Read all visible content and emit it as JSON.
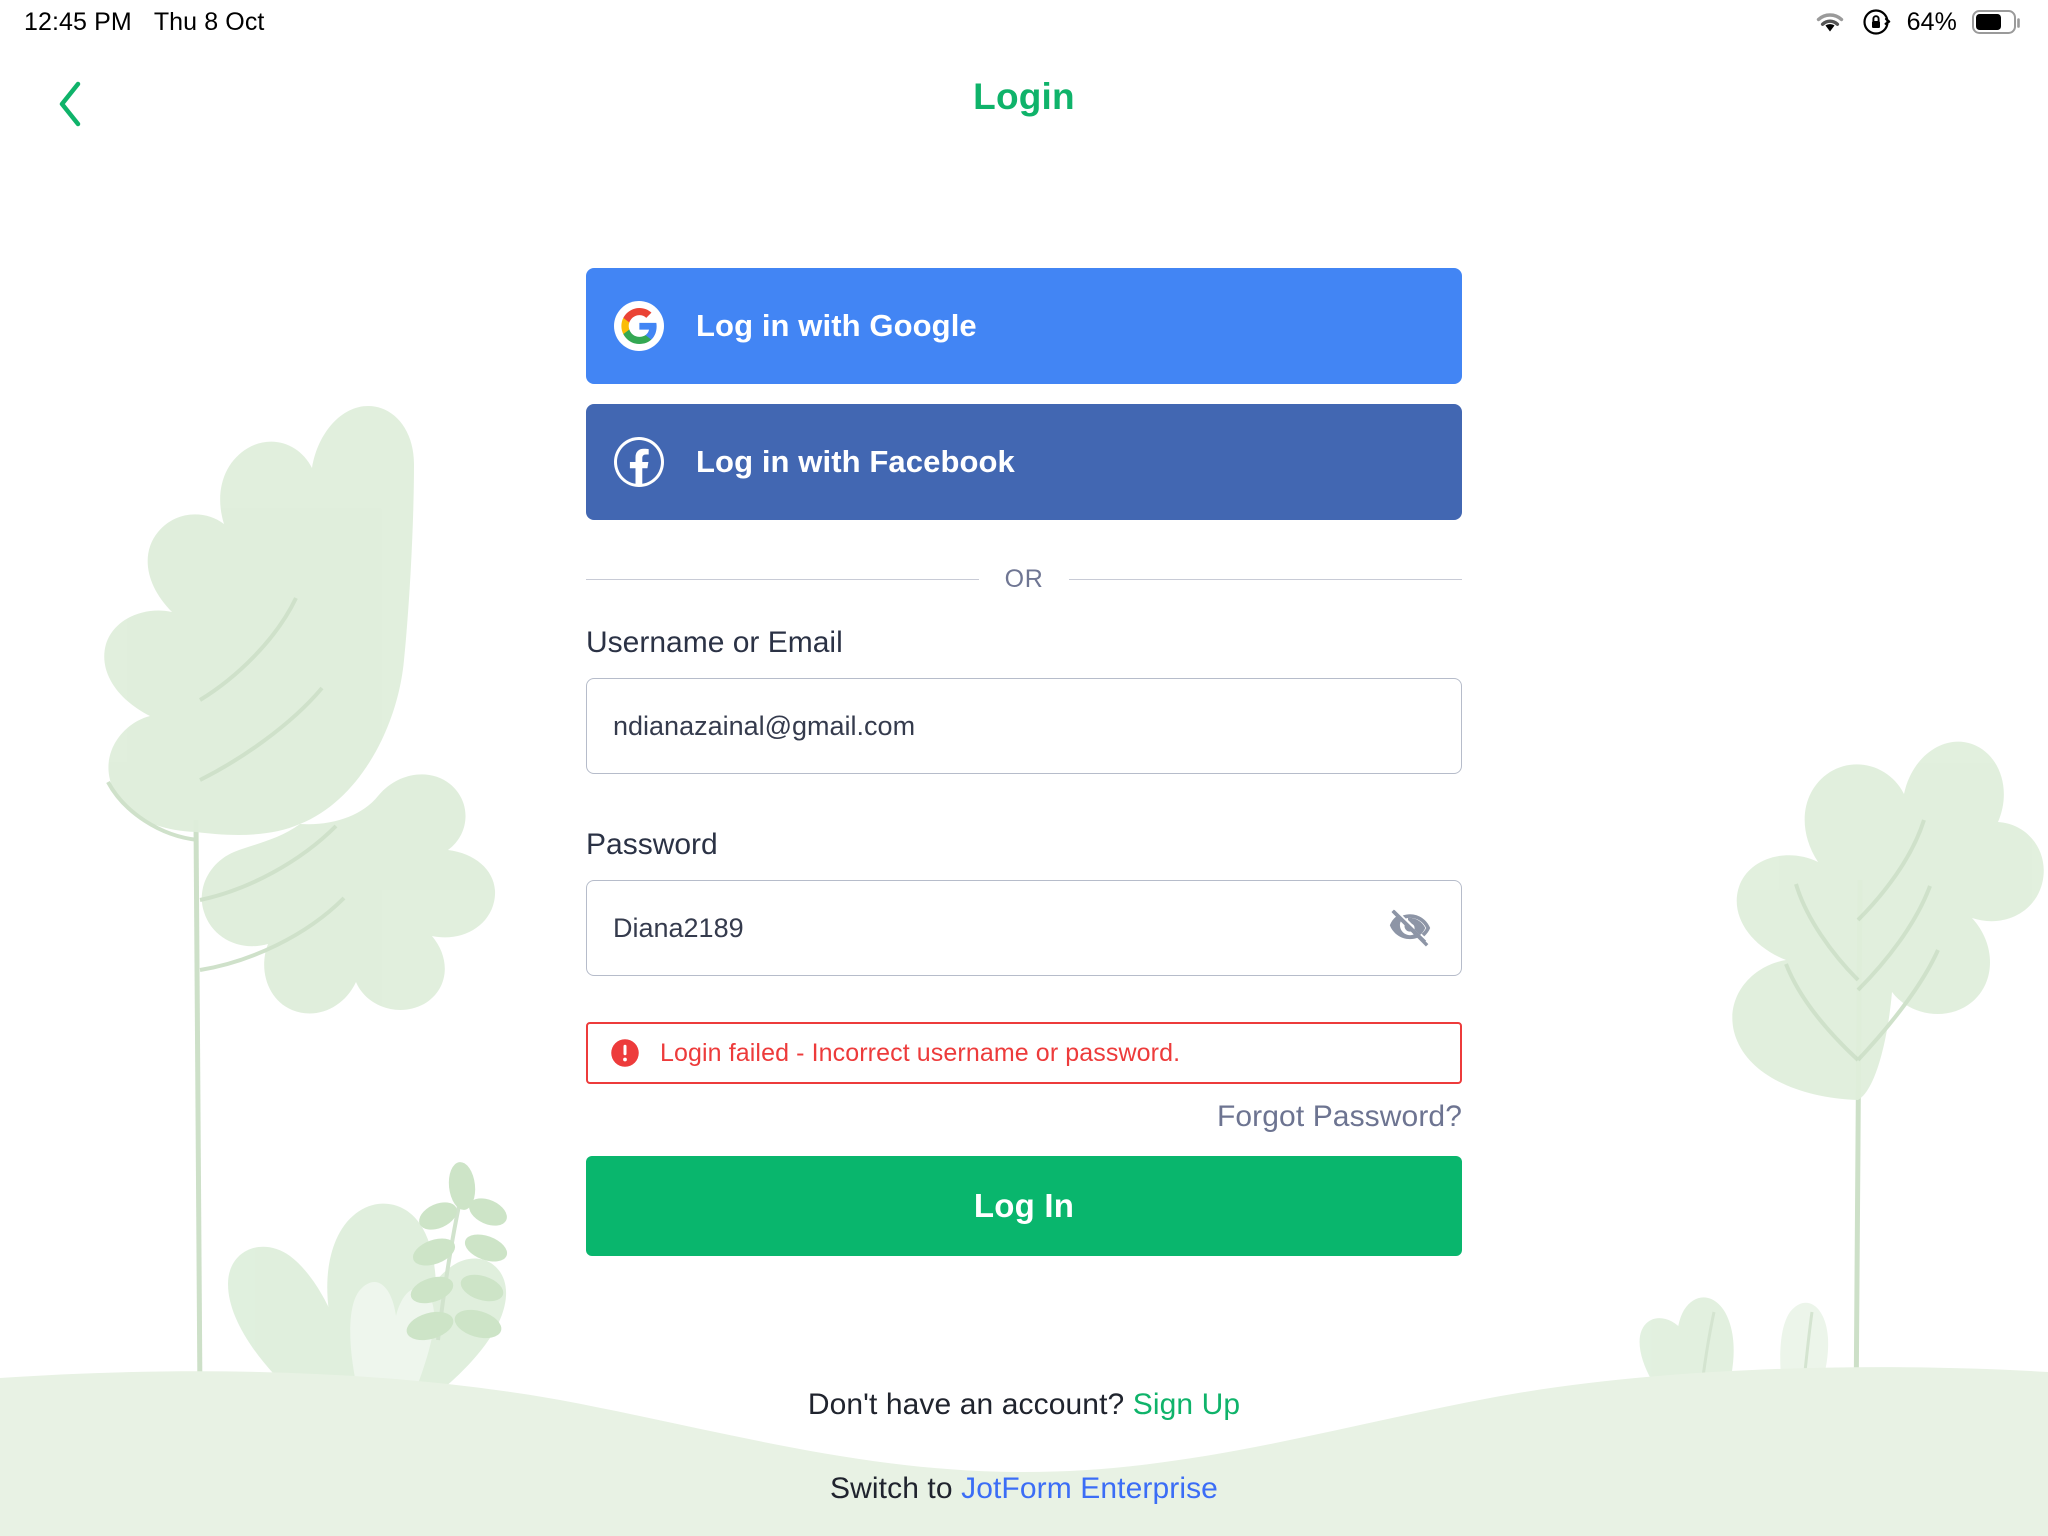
{
  "status_bar": {
    "time": "12:45 PM",
    "date": "Thu 8 Oct",
    "battery_percent": "64%",
    "icons": [
      "wifi-icon",
      "rotation-lock-icon",
      "battery-icon"
    ]
  },
  "header": {
    "back_icon": "chevron-left-icon",
    "title": "Login",
    "title_color": "#0fb36a"
  },
  "social": {
    "google": {
      "label": "Log in with Google",
      "icon": "google-g-icon",
      "background": "#4285f4"
    },
    "facebook": {
      "label": "Log in with Facebook",
      "icon": "facebook-f-icon",
      "background": "#4267b2"
    }
  },
  "divider": {
    "label": "OR"
  },
  "form": {
    "username": {
      "label": "Username or Email",
      "value": "ndianazainal@gmail.com",
      "placeholder": "Username or Email"
    },
    "password": {
      "label": "Password",
      "value": "Diana2189",
      "placeholder": "Password",
      "toggle_icon": "eye-off-icon"
    },
    "error": {
      "icon": "error-exclamation-icon",
      "message": "Login failed - Incorrect username or password.",
      "color": "#ed3b3b"
    },
    "forgot_password": "Forgot Password?",
    "submit_label": "Log In",
    "submit_color": "#09b66d"
  },
  "footer": {
    "signup_prompt": "Don't have an account? ",
    "signup_link": "Sign Up",
    "signup_link_color": "#0fb36a",
    "enterprise_prompt": "Switch to ",
    "enterprise_link": "JotForm Enterprise",
    "enterprise_link_color": "#3b6df6"
  },
  "decoration": {
    "leaf_fill": "#dcecd9",
    "hill_fill": "#e7f1e3",
    "vein_stroke": "#cde0c8"
  }
}
